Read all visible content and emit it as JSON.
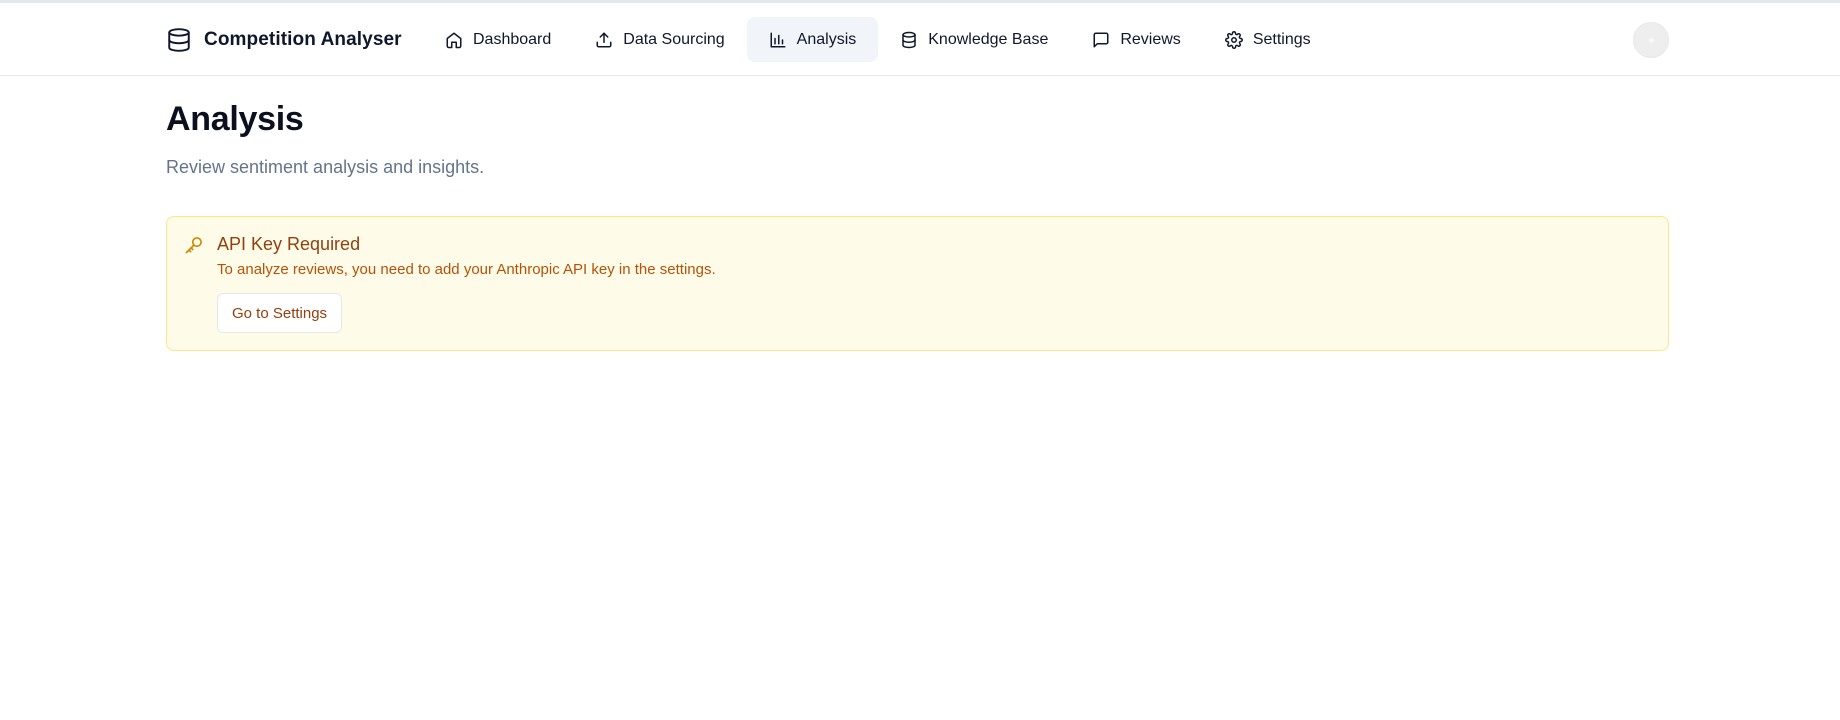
{
  "app": {
    "title": "Competition Analyser",
    "logo_icon": "database-icon"
  },
  "nav": {
    "items": [
      {
        "label": "Dashboard",
        "icon": "home-icon",
        "active": false
      },
      {
        "label": "Data Sourcing",
        "icon": "upload-icon",
        "active": false
      },
      {
        "label": "Analysis",
        "icon": "bar-chart-icon",
        "active": true
      },
      {
        "label": "Knowledge Base",
        "icon": "database-icon",
        "active": false
      },
      {
        "label": "Reviews",
        "icon": "message-square-icon",
        "active": false
      },
      {
        "label": "Settings",
        "icon": "gear-icon",
        "active": false
      }
    ]
  },
  "page": {
    "title": "Analysis",
    "subtitle": "Review sentiment analysis and insights."
  },
  "alert": {
    "icon": "key-icon",
    "title": "API Key Required",
    "description": "To analyze reviews, you need to add your Anthropic API key in the settings.",
    "button_label": "Go to Settings"
  },
  "colors": {
    "active_nav_bg": "#f1f5f9",
    "alert_bg": "#fefbe8",
    "alert_border": "#fde68a",
    "alert_text": "#92400e",
    "subtitle_text": "#64748b"
  }
}
